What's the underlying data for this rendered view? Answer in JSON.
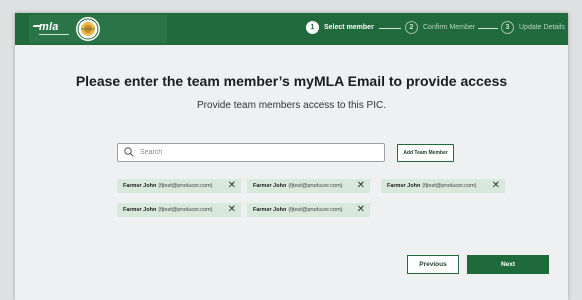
{
  "header": {
    "logo_text": "mla",
    "steps": [
      {
        "number": "1",
        "label": "Select member",
        "state": "active"
      },
      {
        "number": "2",
        "label": "Confirm Member",
        "state": "pending"
      },
      {
        "number": "3",
        "label": "Update Details",
        "state": "pending"
      }
    ]
  },
  "main": {
    "title": "Please enter the team member’s myMLA Email to provide access",
    "subtitle": "Provide team members access to this PIC.",
    "search": {
      "placeholder": "Search",
      "value": ""
    },
    "add_button_label": "Add Team Member",
    "members": [
      {
        "name": "Farmer John",
        "email": "(fjtest@producer.com)"
      },
      {
        "name": "Farmer John",
        "email": "(fjtest@producer.com)"
      },
      {
        "name": "Farmer John",
        "email": "(fjtest@producer.com)"
      },
      {
        "name": "Farmer John",
        "email": "(fjtest@producer.com)"
      },
      {
        "name": "Farmer John",
        "email": "(fjtest@producer.com)"
      }
    ],
    "close_glyph": "✕"
  },
  "footer": {
    "previous_label": "Previous",
    "next_label": "Next"
  },
  "colors": {
    "brand_green": "#206a3c",
    "chip_bg": "#d8e8dd",
    "page_bg": "#eff0f2"
  }
}
